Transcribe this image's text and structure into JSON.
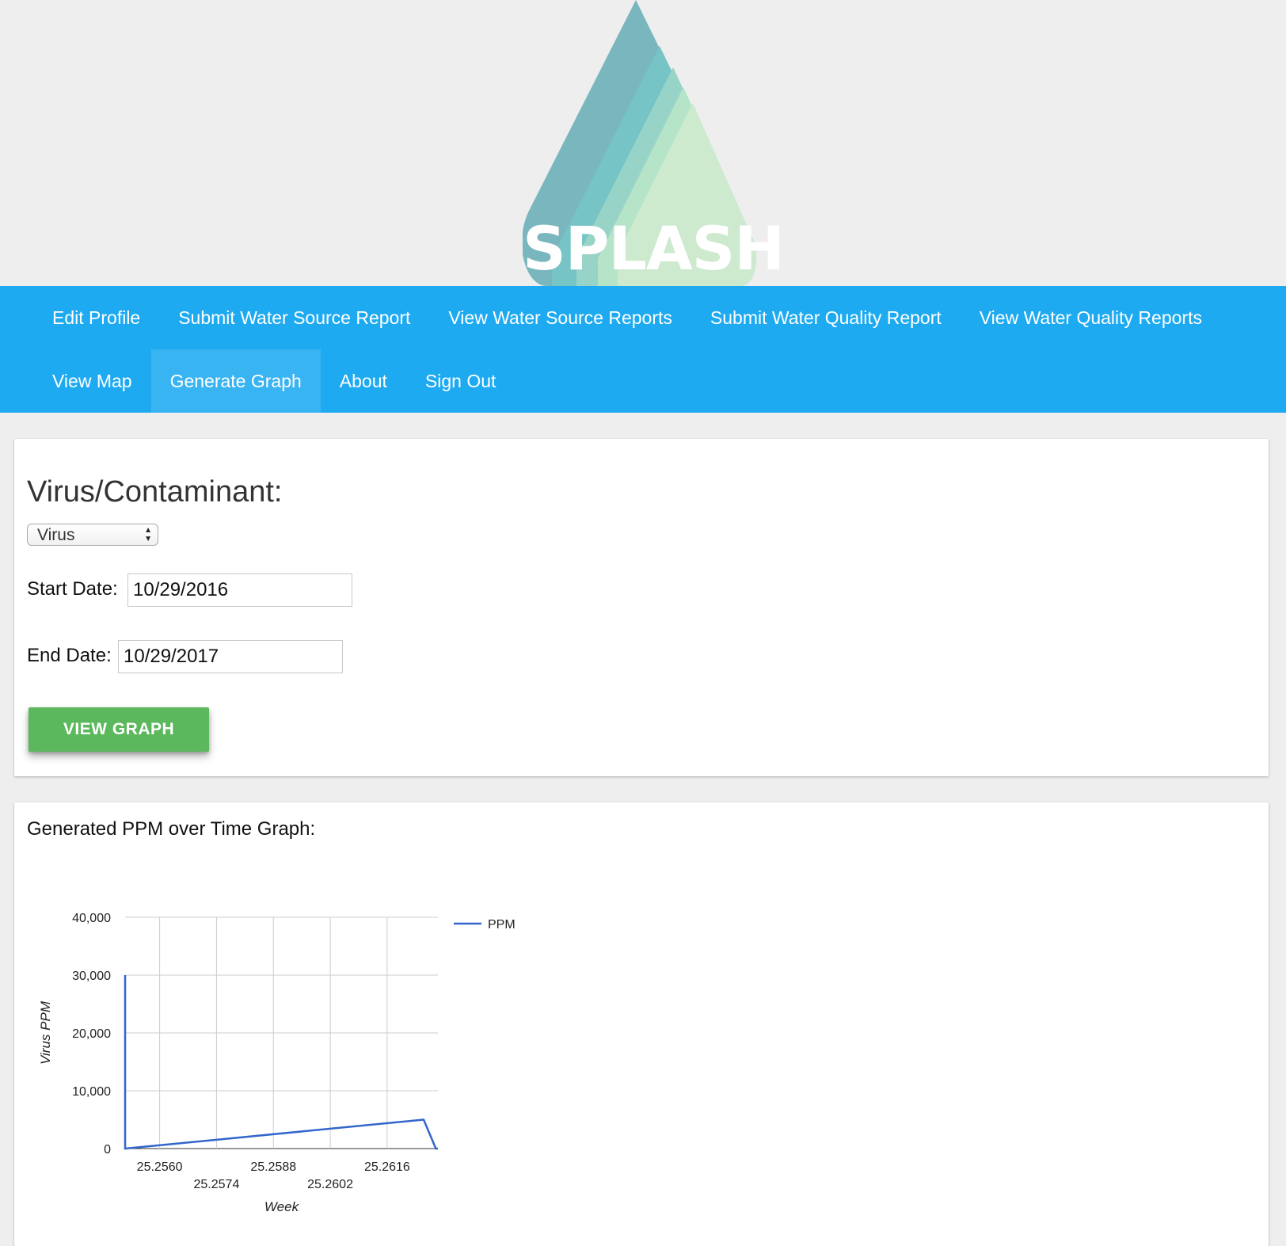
{
  "header": {
    "logo_text": "SPLASH"
  },
  "nav": {
    "row1": [
      "Edit Profile",
      "Submit Water Source Report",
      "View Water Source Reports",
      "Submit Water Quality Report",
      "View Water Quality Reports"
    ],
    "row2": [
      "View Map",
      "Generate Graph",
      "About",
      "Sign Out"
    ],
    "active": "Generate Graph"
  },
  "form": {
    "title": "Virus/Contaminant:",
    "type_selected": "Virus",
    "start_label": "Start Date:",
    "start_value": "10/29/2016",
    "end_label": "End Date:",
    "end_value": "10/29/2017",
    "button_label": "VIEW GRAPH"
  },
  "graph": {
    "title": "Generated PPM over Time Graph:"
  },
  "colors": {
    "navbar": "#1eaaf1",
    "button": "#5cb85c",
    "line": "#3366cc"
  },
  "chart_data": {
    "type": "line",
    "xlabel": "Week",
    "ylabel": "Virus PPM",
    "ylim": [
      0,
      40000
    ],
    "xlim": [
      25.25515,
      25.26285
    ],
    "yticks": [
      0,
      10000,
      20000,
      30000,
      40000
    ],
    "ytick_labels": [
      "0",
      "10,000",
      "20,000",
      "30,000",
      "40,000"
    ],
    "xticks": [
      25.256,
      25.2574,
      25.2588,
      25.2602,
      25.2616
    ],
    "xtick_labels": [
      "25.2560",
      "25.2574",
      "25.2588",
      "25.2602",
      "25.2616"
    ],
    "grid": true,
    "legend": "right",
    "series": [
      {
        "name": "PPM",
        "x": [
          25.25515,
          25.25515,
          25.2625,
          25.2628,
          25.26285
        ],
        "y": [
          30000,
          0,
          5000,
          0,
          0
        ]
      }
    ]
  }
}
